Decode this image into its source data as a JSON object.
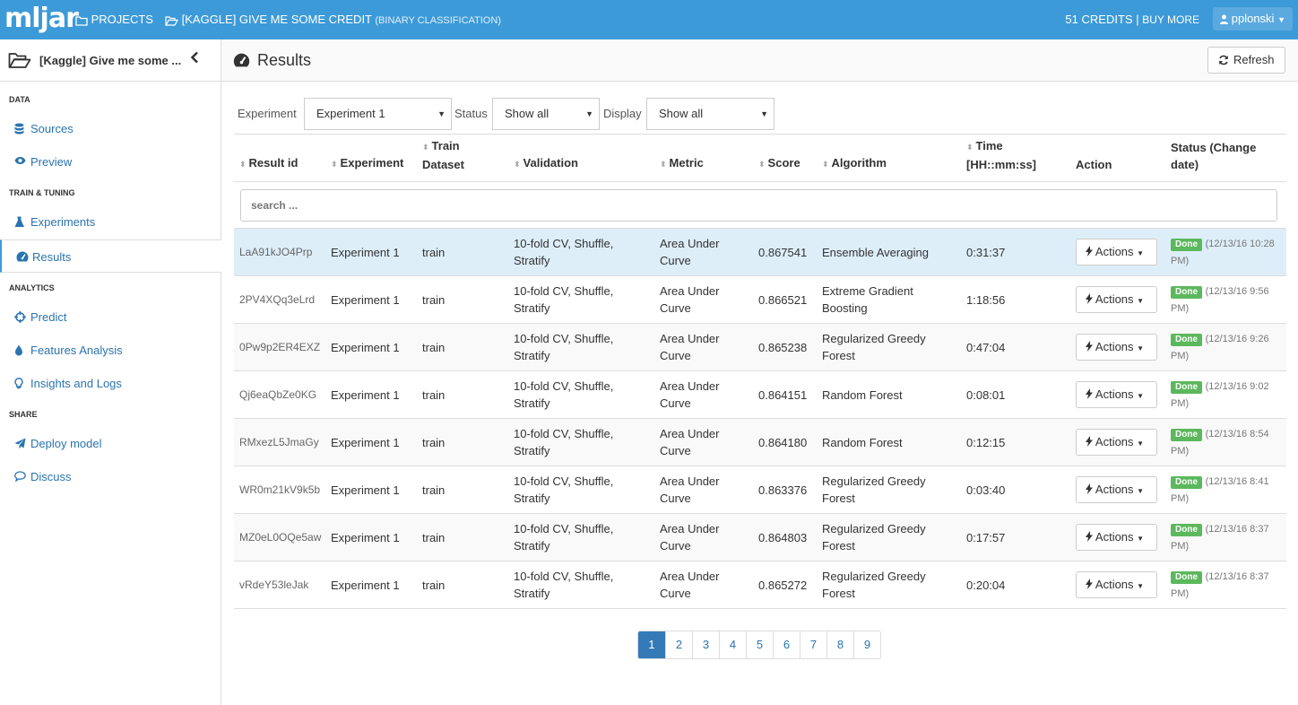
{
  "topbar": {
    "logo": "mljar",
    "projects_label": "PROJECTS",
    "project_label": "[KAGGLE] GIVE ME SOME CREDIT",
    "project_sub": "(BINARY CLASSIFICATION)",
    "credits": "51 CREDITS",
    "separator": "|",
    "buy_more": "BUY MORE",
    "user": "pplonski"
  },
  "sidebar": {
    "project_title": "[Kaggle] Give me some ...",
    "sections": {
      "data": "DATA",
      "train": "TRAIN & TUNING",
      "analytics": "ANALYTICS",
      "share": "SHARE"
    },
    "items": [
      {
        "label": "Sources"
      },
      {
        "label": "Preview"
      },
      {
        "label": "Experiments"
      },
      {
        "label": "Results"
      },
      {
        "label": "Predict"
      },
      {
        "label": "Features Analysis"
      },
      {
        "label": "Insights and Logs"
      },
      {
        "label": "Deploy model"
      },
      {
        "label": "Discuss"
      }
    ]
  },
  "page": {
    "title": "Results",
    "refresh": "Refresh"
  },
  "filters": {
    "experiment_label": "Experiment",
    "experiment_value": "Experiment 1",
    "status_label": "Status",
    "status_value": "Show all",
    "display_label": "Display",
    "display_value": "Show all"
  },
  "table": {
    "headers": {
      "result_id": "Result id",
      "experiment": "Experiment",
      "train_dataset": "Train Dataset",
      "validation": "Validation",
      "metric": "Metric",
      "score": "Score",
      "algorithm": "Algorithm",
      "time": "Time [HH::mm:ss]",
      "action": "Action",
      "status": "Status (Change date)"
    },
    "search_placeholder": "search ...",
    "action_label": "Actions",
    "rows": [
      {
        "id": "LaA91kJO4Prp",
        "experiment": "Experiment 1",
        "train": "train",
        "validation": "10-fold CV, Shuffle, Stratify",
        "metric": "Area Under Curve",
        "score": "0.867541",
        "algorithm": "Ensemble Averaging",
        "time": "0:31:37",
        "status": "Done",
        "date": "(12/13/16 10:28 PM)"
      },
      {
        "id": "2PV4XQq3eLrd",
        "experiment": "Experiment 1",
        "train": "train",
        "validation": "10-fold CV, Shuffle, Stratify",
        "metric": "Area Under Curve",
        "score": "0.866521",
        "algorithm": "Extreme Gradient Boosting",
        "time": "1:18:56",
        "status": "Done",
        "date": "(12/13/16 9:56 PM)"
      },
      {
        "id": "0Pw9p2ER4EXZ",
        "experiment": "Experiment 1",
        "train": "train",
        "validation": "10-fold CV, Shuffle, Stratify",
        "metric": "Area Under Curve",
        "score": "0.865238",
        "algorithm": "Regularized Greedy Forest",
        "time": "0:47:04",
        "status": "Done",
        "date": "(12/13/16 9:26 PM)"
      },
      {
        "id": "Qj6eaQbZe0KG",
        "experiment": "Experiment 1",
        "train": "train",
        "validation": "10-fold CV, Shuffle, Stratify",
        "metric": "Area Under Curve",
        "score": "0.864151",
        "algorithm": "Random Forest",
        "time": "0:08:01",
        "status": "Done",
        "date": "(12/13/16 9:02 PM)"
      },
      {
        "id": "RMxezL5JmaGy",
        "experiment": "Experiment 1",
        "train": "train",
        "validation": "10-fold CV, Shuffle, Stratify",
        "metric": "Area Under Curve",
        "score": "0.864180",
        "algorithm": "Random Forest",
        "time": "0:12:15",
        "status": "Done",
        "date": "(12/13/16 8:54 PM)"
      },
      {
        "id": "WR0m21kV9k5b",
        "experiment": "Experiment 1",
        "train": "train",
        "validation": "10-fold CV, Shuffle, Stratify",
        "metric": "Area Under Curve",
        "score": "0.863376",
        "algorithm": "Regularized Greedy Forest",
        "time": "0:03:40",
        "status": "Done",
        "date": "(12/13/16 8:41 PM)"
      },
      {
        "id": "MZ0eL0OQe5aw",
        "experiment": "Experiment 1",
        "train": "train",
        "validation": "10-fold CV, Shuffle, Stratify",
        "metric": "Area Under Curve",
        "score": "0.864803",
        "algorithm": "Regularized Greedy Forest",
        "time": "0:17:57",
        "status": "Done",
        "date": "(12/13/16 8:37 PM)"
      },
      {
        "id": "vRdeY53leJak",
        "experiment": "Experiment 1",
        "train": "train",
        "validation": "10-fold CV, Shuffle, Stratify",
        "metric": "Area Under Curve",
        "score": "0.865272",
        "algorithm": "Regularized Greedy Forest",
        "time": "0:20:04",
        "status": "Done",
        "date": "(12/13/16 8:37 PM)"
      }
    ]
  },
  "pagination": {
    "pages": [
      "1",
      "2",
      "3",
      "4",
      "5",
      "6",
      "7",
      "8",
      "9"
    ],
    "current": "1"
  },
  "colors": {
    "topbar": "#3d9ad8",
    "link": "#2a74b0",
    "highlight_row": "#ddeef9",
    "done_badge": "#5cb85c",
    "active_page": "#337ab7"
  }
}
